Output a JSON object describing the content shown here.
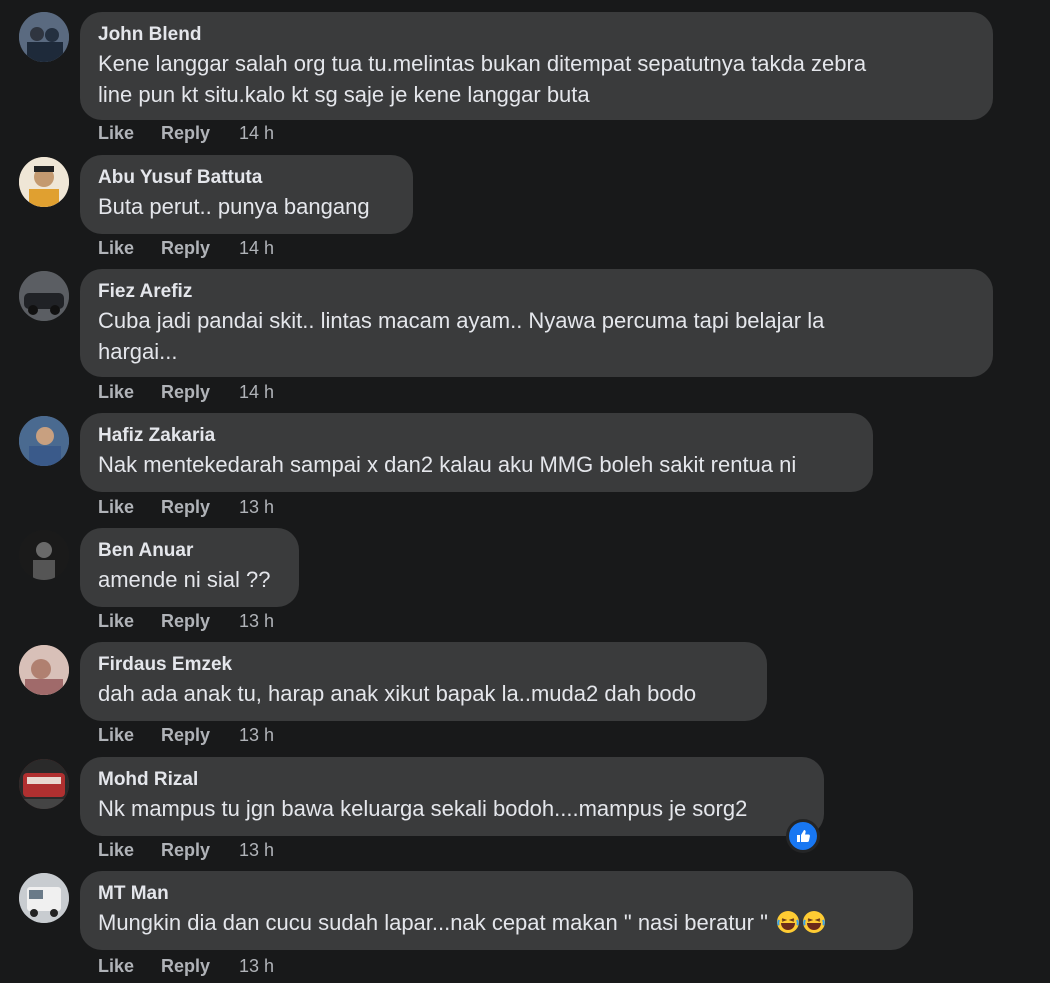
{
  "actions": {
    "like": "Like",
    "reply": "Reply"
  },
  "comments": [
    {
      "author": "John Blend",
      "text": "Kene langgar salah org tua tu.melintas bukan ditempat sepatutnya takda zebra\nline pun kt situ.kalo kt sg saje je kene langgar buta",
      "time": "14 h",
      "avatar_color": "#5a6a80"
    },
    {
      "author": "Abu Yusuf Battuta",
      "text": "Buta perut.. punya bangang",
      "time": "14 h",
      "avatar_color": "#d8c8b0"
    },
    {
      "author": "Fiez Arefiz",
      "text": "Cuba jadi pandai skit.. lintas macam ayam.. Nyawa percuma tapi belajar la\nhargai...",
      "time": "14 h",
      "avatar_color": "#4a4c50"
    },
    {
      "author": "Hafiz Zakaria",
      "text": "Nak mentekedarah sampai x dan2 kalau aku MMG boleh sakit rentua ni",
      "time": "13 h",
      "avatar_color": "#6a7c99"
    },
    {
      "author": "Ben Anuar",
      "text": "amende ni sial ??",
      "time": "13 h",
      "avatar_color": "#222222"
    },
    {
      "author": "Firdaus Emzek",
      "text": "dah ada anak tu, harap anak xikut bapak la..muda2 dah bodo",
      "time": "13 h",
      "avatar_color": "#c9a7a0"
    },
    {
      "author": "Mohd Rizal",
      "text": "Nk mampus tu jgn bawa keluarga sekali bodoh....mampus je sorg2",
      "time": "13 h",
      "avatar_color": "#8a2a2a"
    },
    {
      "author": "MT Man",
      "text": "Mungkin dia dan cucu sudah lapar...nak cepat makan \" nasi beratur \"",
      "time": "13 h",
      "avatar_color": "#9aa0a8",
      "emoji": [
        "laughing-emoji",
        "laughing-emoji"
      ]
    }
  ]
}
